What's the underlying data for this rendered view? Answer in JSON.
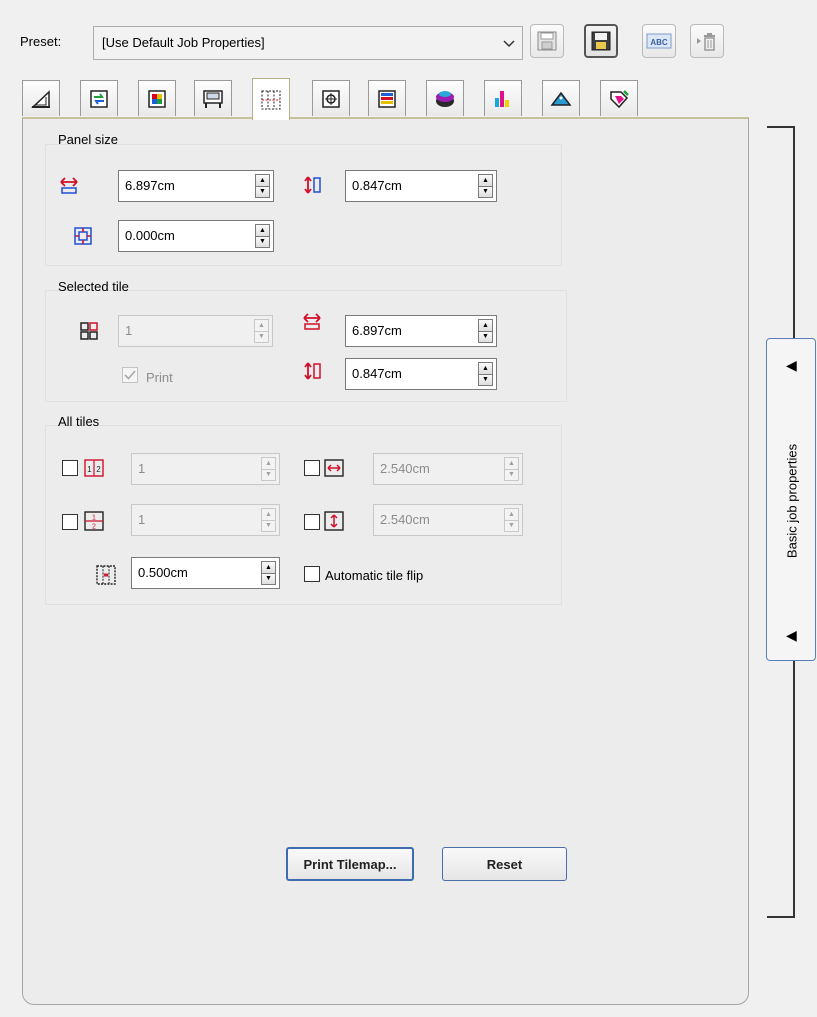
{
  "preset": {
    "label": "Preset:",
    "value": "[Use Default Job Properties]",
    "buttons": [
      "save-icon",
      "save-as-icon",
      "rename-icon",
      "delete-icon"
    ],
    "rename_glyph": "ABC"
  },
  "tabs": [
    {
      "icon": "media-icon"
    },
    {
      "icon": "transform-icon"
    },
    {
      "icon": "color-icon"
    },
    {
      "icon": "printer-icon"
    },
    {
      "icon": "tiling-icon",
      "active": true
    },
    {
      "icon": "marks-icon"
    },
    {
      "icon": "layers-icon"
    },
    {
      "icon": "layout-icon"
    },
    {
      "icon": "ink-icon"
    },
    {
      "icon": "cut-icon"
    },
    {
      "icon": "profile-icon"
    }
  ],
  "panel_size": {
    "title": "Panel size",
    "width": "6.897cm",
    "height": "0.847cm",
    "overlap": "0.000cm"
  },
  "selected_tile": {
    "title": "Selected tile",
    "tile_number": "1",
    "print_label": "Print",
    "width": "6.897cm",
    "height": "0.847cm"
  },
  "all_tiles": {
    "title": "All tiles",
    "columns": "1",
    "rows": "1",
    "tile_width": "2.540cm",
    "tile_height": "2.540cm",
    "gap": "0.500cm",
    "auto_flip_label": "Automatic tile flip"
  },
  "buttons": {
    "print_tilemap": "Print Tilemap...",
    "reset": "Reset"
  },
  "side_panel": {
    "label": "Basic job properties",
    "arrow_top": "◀",
    "arrow_bottom": "◀"
  },
  "colors": {
    "accent_red": "#d0102a",
    "accent_blue": "#1e4fd8",
    "focus_border": "#3f6bb3"
  }
}
